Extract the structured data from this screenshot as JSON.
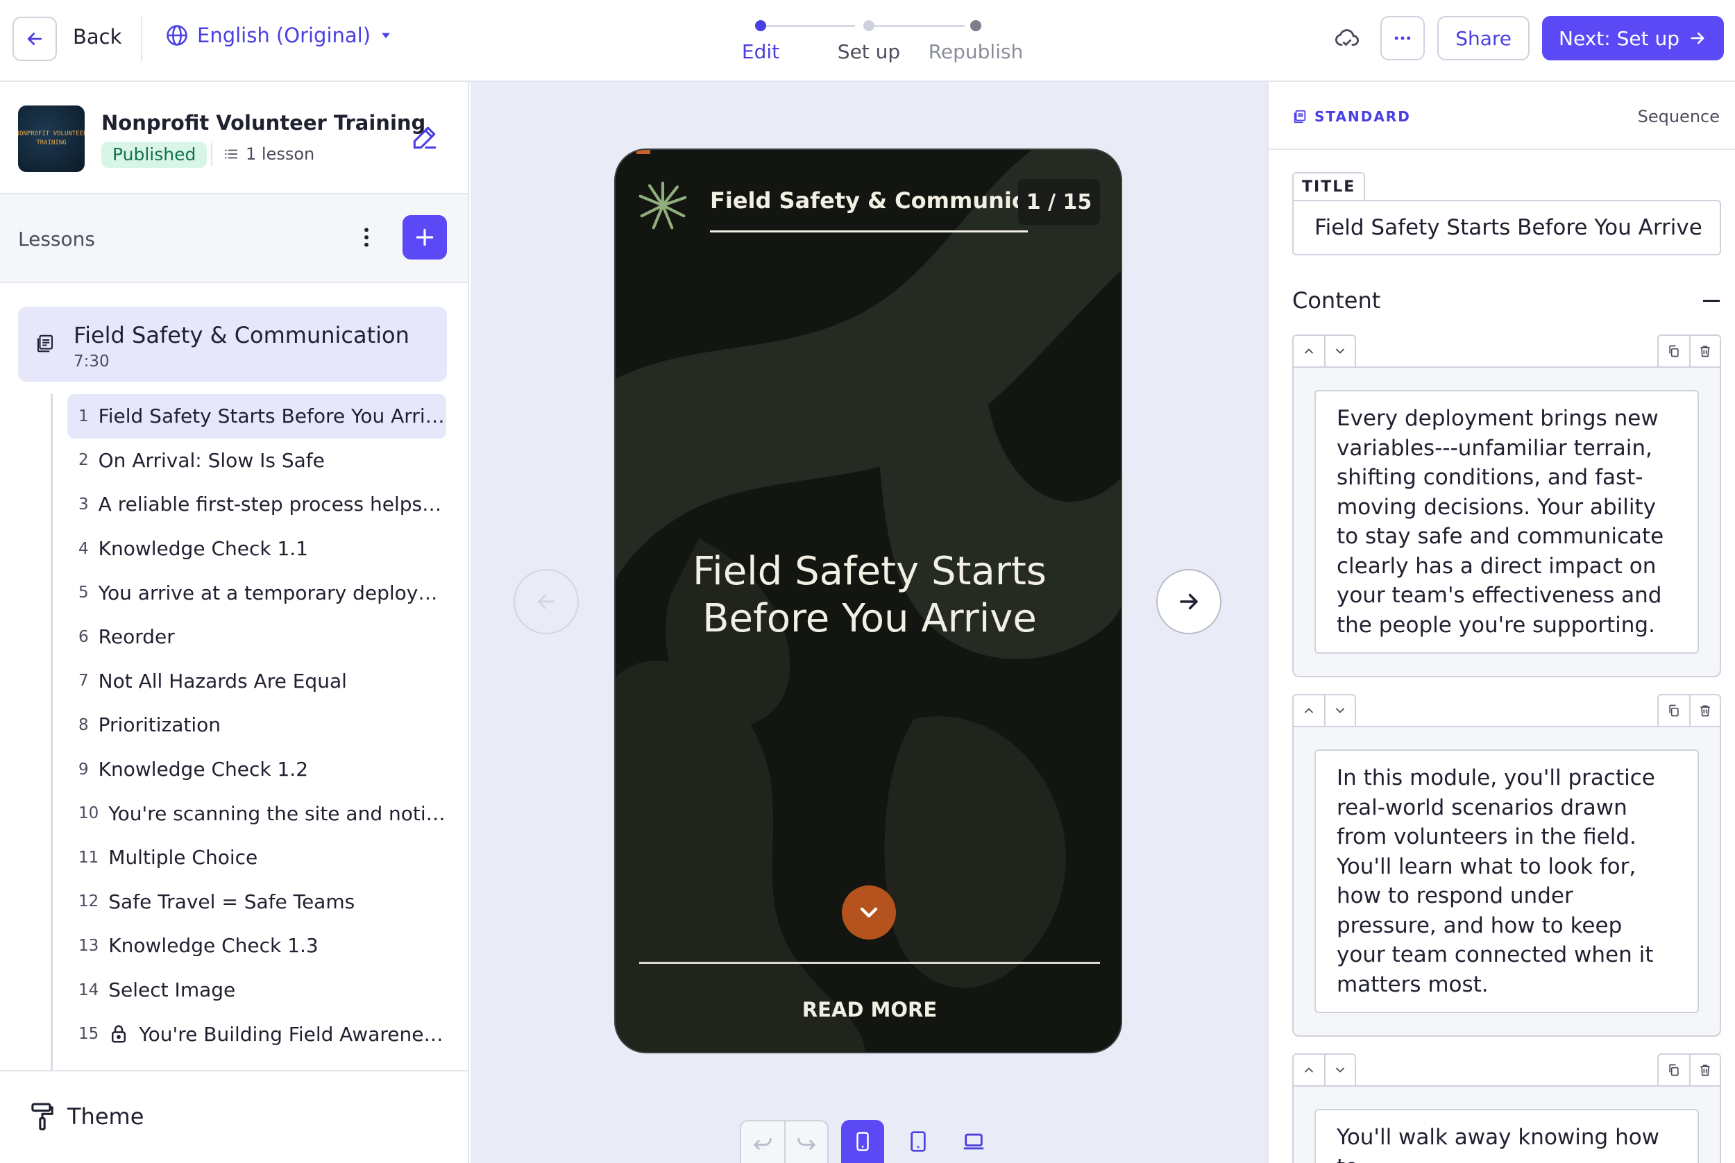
{
  "topbar": {
    "back_label": "Back",
    "language": "English (Original)",
    "steps": [
      {
        "label": "Edit",
        "state": "current"
      },
      {
        "label": "Set up",
        "state": "upcoming"
      },
      {
        "label": "Republish",
        "state": "upcoming"
      }
    ],
    "share_label": "Share",
    "next_label": "Next: Set up"
  },
  "course": {
    "title": "Nonprofit Volunteer Training",
    "thumb_text_1": "NONPROFIT VOLUNTEER",
    "thumb_text_2": "TRAINING",
    "status": "Published",
    "lesson_count": "1 lesson"
  },
  "lessons": {
    "header": "Lessons",
    "group": {
      "title": "Field Safety & Communication",
      "duration": "7:30"
    },
    "slides": [
      {
        "num": "1",
        "title": "Field Safety Starts Before You Arrive"
      },
      {
        "num": "2",
        "title": "On Arrival: Slow Is Safe"
      },
      {
        "num": "3",
        "title": "A reliable first-step process helps y..."
      },
      {
        "num": "4",
        "title": "Knowledge Check 1.1"
      },
      {
        "num": "5",
        "title": "You arrive at a temporary deploym..."
      },
      {
        "num": "6",
        "title": "Reorder"
      },
      {
        "num": "7",
        "title": "Not All Hazards Are Equal"
      },
      {
        "num": "8",
        "title": "Prioritization"
      },
      {
        "num": "9",
        "title": "Knowledge Check 1.2"
      },
      {
        "num": "10",
        "title": "You're scanning the site and notic..."
      },
      {
        "num": "11",
        "title": "Multiple Choice"
      },
      {
        "num": "12",
        "title": "Safe Travel = Safe Teams"
      },
      {
        "num": "13",
        "title": "Knowledge Check 1.3"
      },
      {
        "num": "14",
        "title": "Select Image"
      },
      {
        "num": "15",
        "title": "You're Building Field Awareness!"
      }
    ]
  },
  "theme": {
    "label": "Theme"
  },
  "preview": {
    "course_title": "Field Safety & Communic...",
    "counter": "1 / 15",
    "slide_title": "Field Safety Starts Before You Arrive",
    "read_more": "READ MORE"
  },
  "panel": {
    "type_label": "STANDARD",
    "sequence_label": "Sequence",
    "title_tag": "TITLE",
    "title_value": "Field Safety Starts Before You Arrive",
    "content_label": "Content",
    "blocks": [
      {
        "text": "Every deployment brings new variables---unfamiliar terrain, shifting conditions, and fast-moving decisions. Your ability to stay safe and communicate clearly has a direct impact on your team's effectiveness and the people you're supporting."
      },
      {
        "text": "In this module, you'll practice real-world scenarios drawn from volunteers in the field. You'll learn what to look for, how to respond under pressure, and how to keep your team connected when it matters most."
      },
      {
        "text": "You'll walk away knowing how to:"
      }
    ]
  },
  "colors": {
    "accent": "#5b49f5",
    "link": "#4a3fe0",
    "published_bg": "#d9f5e8",
    "phone_bg": "#131511",
    "phone_accent": "#b4531d"
  }
}
